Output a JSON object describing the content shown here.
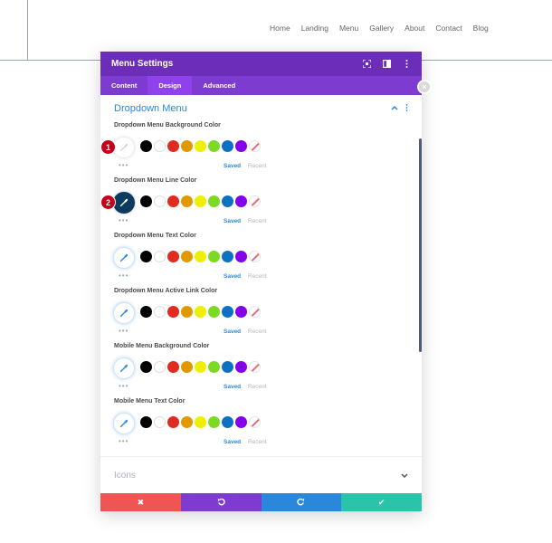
{
  "site_nav": [
    "Home",
    "Landing",
    "Menu",
    "Gallery",
    "About",
    "Contact",
    "Blog"
  ],
  "modal": {
    "title": "Menu Settings",
    "tabs": [
      {
        "label": "Content",
        "active": false
      },
      {
        "label": "Design",
        "active": true
      },
      {
        "label": "Advanced",
        "active": false
      }
    ],
    "section_title": "Dropdown Menu",
    "collapsed_section_title": "Icons"
  },
  "swatch_colors": [
    "#000000",
    "#ffffff",
    "#e02b20",
    "#e09900",
    "#edf000",
    "#7cda24",
    "#0c71c3",
    "#8300e9"
  ],
  "fields": [
    {
      "label": "Dropdown Menu Background Color",
      "saved": "Saved",
      "recent": "Recent",
      "badge": "1",
      "picker_state": "empty"
    },
    {
      "label": "Dropdown Menu Line Color",
      "saved": "Saved",
      "recent": "Recent",
      "badge": "2",
      "picker_state": "dark"
    },
    {
      "label": "Dropdown Menu Text Color",
      "saved": "Saved",
      "recent": "Recent",
      "badge": "",
      "picker_state": "default"
    },
    {
      "label": "Dropdown Menu Active Link Color",
      "saved": "Saved",
      "recent": "Recent",
      "badge": "",
      "picker_state": "default"
    },
    {
      "label": "Mobile Menu Background Color",
      "saved": "Saved",
      "recent": "Recent",
      "badge": "",
      "picker_state": "default"
    },
    {
      "label": "Mobile Menu Text Color",
      "saved": "Saved",
      "recent": "Recent",
      "badge": "",
      "picker_state": "default"
    }
  ],
  "footer": {
    "colors": {
      "cancel": "#ef5555",
      "undo": "#7e3bd0",
      "redo": "#2b87da",
      "save": "#29c4a9"
    }
  },
  "colors": {
    "accent": "#2b87da",
    "header": "#6c2eb9",
    "badge": "#c4001a"
  }
}
